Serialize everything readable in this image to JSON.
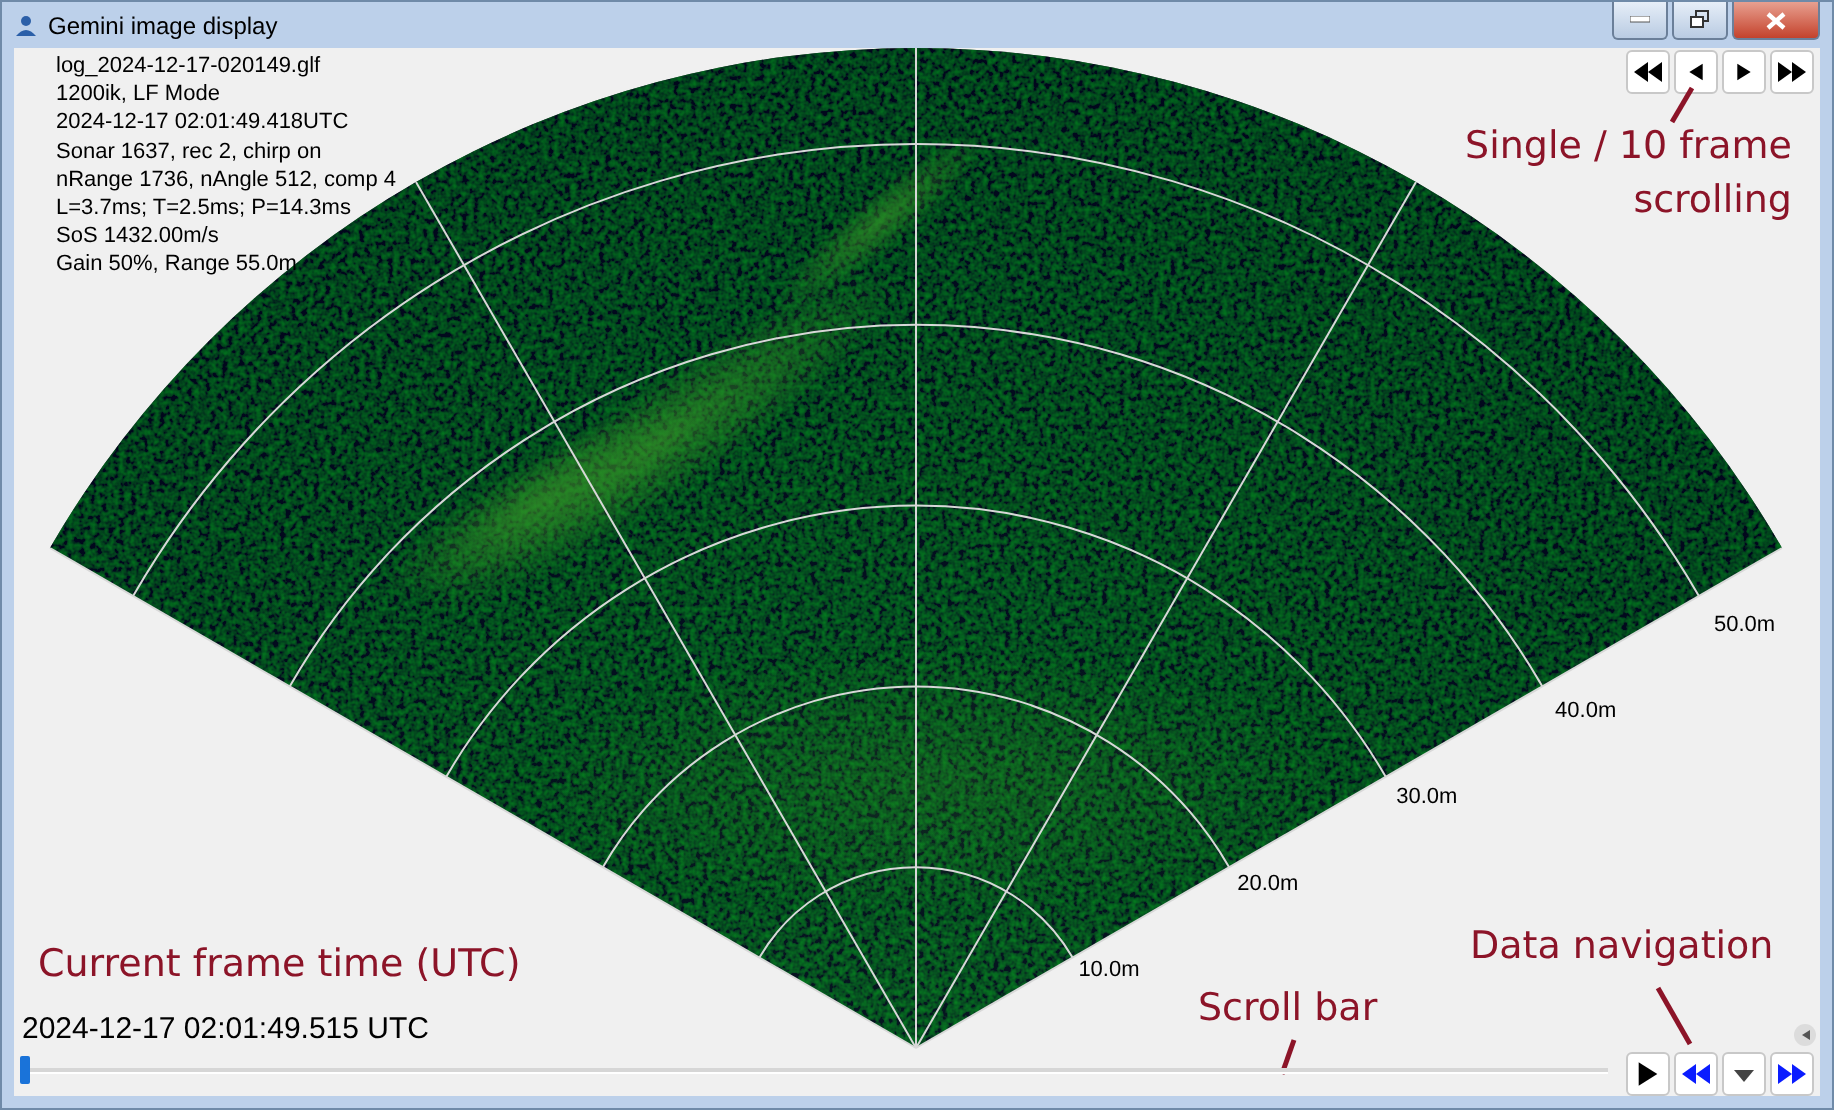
{
  "window": {
    "title": "Gemini image display"
  },
  "info_lines": [
    "log_2024-12-17-020149.glf",
    "1200ik, LF Mode",
    "2024-12-17 02:01:49.418UTC",
    "Sonar 1637, rec 2, chirp on",
    "nRange 1736, nAngle 512, comp 4",
    "L=3.7ms; T=2.5ms; P=14.3ms",
    "SoS 1432.00m/s",
    "Gain 50%, Range 55.0m"
  ],
  "range_labels": [
    "10.0m",
    "20.0m",
    "30.0m",
    "40.0m",
    "50.0m"
  ],
  "frame_buttons": [
    {
      "kind": "double-left"
    },
    {
      "kind": "left"
    },
    {
      "kind": "right"
    },
    {
      "kind": "double-right"
    }
  ],
  "annotations": [
    {
      "kind": "frame-scrolling",
      "text": "Single / 10 frame scrolling"
    },
    {
      "kind": "frame-time",
      "text": "Current frame time (UTC)"
    },
    {
      "kind": "scroll-bar",
      "text": "Scroll bar"
    },
    {
      "kind": "navigation",
      "text": "Data navigation"
    }
  ],
  "current_time": "2024-12-17 02:01:49.515 UTC",
  "playback_buttons": [
    {
      "kind": "play"
    },
    {
      "kind": "rewind"
    },
    {
      "kind": "dropdown"
    },
    {
      "kind": "fast-forward"
    }
  ]
}
